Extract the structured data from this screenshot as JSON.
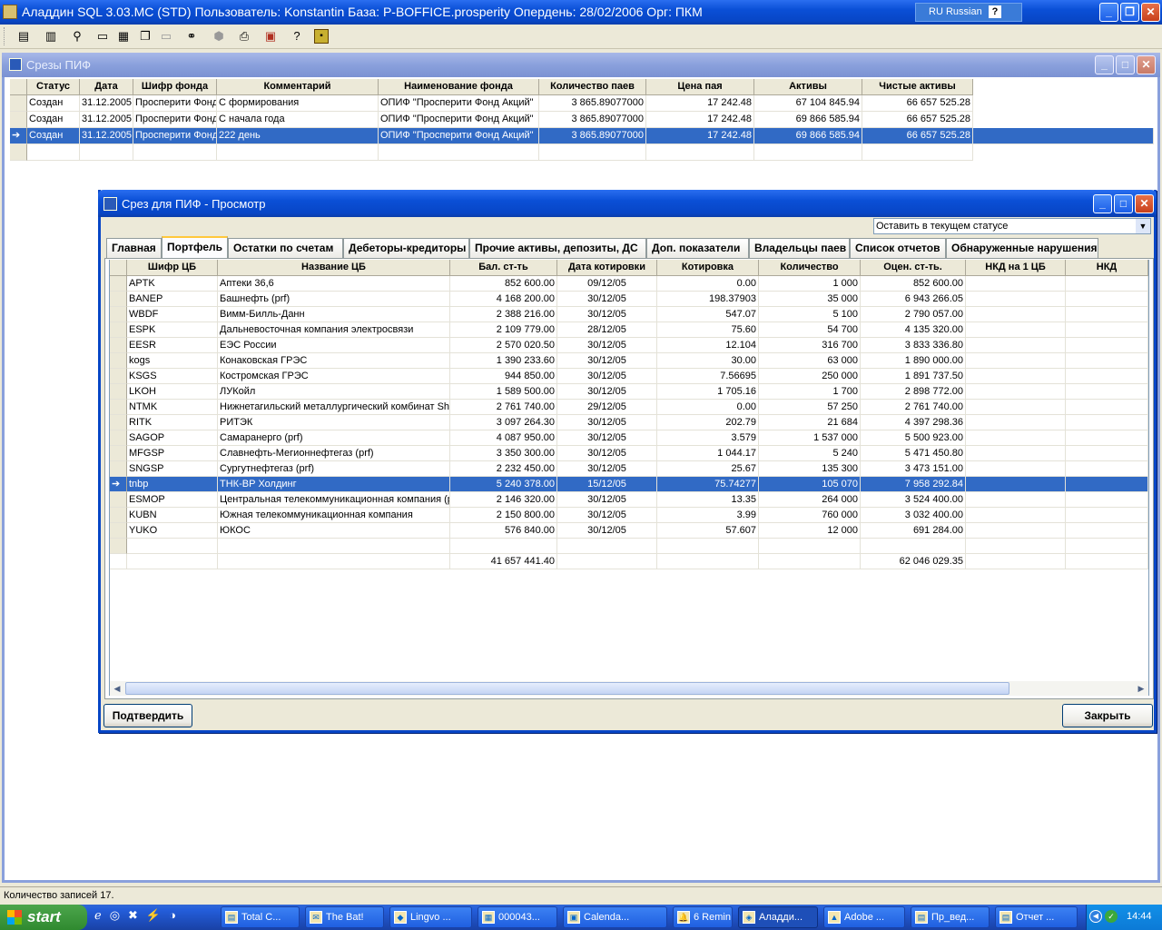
{
  "app": {
    "title": "Аладдин SQL 3.03.MC (STD)  Пользователь: Konstantin База: P-BOFFICE.prosperity Опердень: 28/02/2006 Орг: ПКМ",
    "lang": "RU Russian"
  },
  "toolbar": [
    "report-icon",
    "db-icon",
    "filter-icon",
    "window-icon",
    "tile-icon",
    "cascade-icon",
    "blank-icon",
    "binoculars-icon",
    "stop-icon",
    "print-icon",
    "export-icon",
    "help-icon",
    "module-icon"
  ],
  "outer": {
    "title": "Срезы ПИФ",
    "headers": [
      "Статус",
      "Дата",
      "Шифр фонда",
      "Комментарий",
      "Наименование фонда",
      "Количество паев",
      "Цена пая",
      "Активы",
      "Чистые активы"
    ],
    "rows": [
      [
        "Создан",
        "31.12.2005",
        "Просперити Фонд",
        "С формирования",
        "ОПИФ \"Просперити Фонд Акций\"",
        "3 865.89077000",
        "17 242.48",
        "67 104 845.94",
        "66 657 525.28"
      ],
      [
        "Создан",
        "31.12.2005",
        "Просперити Фонд",
        "С начала года",
        "ОПИФ \"Просперити Фонд Акций\"",
        "3 865.89077000",
        "17 242.48",
        "69 866 585.94",
        "66 657 525.28"
      ],
      [
        "Создан",
        "31.12.2005",
        "Просперити Фонд",
        "222 день",
        "ОПИФ \"Просперити Фонд Акций\"",
        "3 865.89077000",
        "17 242.48",
        "69 866 585.94",
        "66 657 525.28"
      ]
    ]
  },
  "dialog": {
    "title": "Срез для ПИФ - Просмотр",
    "status_select": "Оставить в текущем статусе",
    "tabs": [
      "Главная",
      "Портфель",
      "Остатки по счетам",
      "Дебеторы-кредиторы",
      "Прочие активы, депозиты, ДС",
      "Доп. показатели",
      "Владельцы паев",
      "Список отчетов",
      "Обнаруженные нарушения"
    ],
    "headers": [
      "Шифр ЦБ",
      "Название ЦБ",
      "Бал. ст-ть",
      "Дата котировки",
      "Котировка",
      "Количество",
      "Оцен. ст-ть.",
      "НКД на 1 ЦБ",
      "НКД"
    ],
    "rows": [
      [
        "APTK",
        "Аптеки 36,6",
        "852 600.00",
        "09/12/05",
        "0.00",
        "1 000",
        "852 600.00"
      ],
      [
        "BANEP",
        "Башнефть (prf)",
        "4 168 200.00",
        "30/12/05",
        "198.37903",
        "35 000",
        "6 943 266.05"
      ],
      [
        "WBDF",
        "Вимм-Билль-Данн",
        "2 388 216.00",
        "30/12/05",
        "547.07",
        "5 100",
        "2 790 057.00"
      ],
      [
        "ESPK",
        "Дальневосточная компания электросвязи",
        "2 109 779.00",
        "28/12/05",
        "75.60",
        "54 700",
        "4 135 320.00"
      ],
      [
        "EESR",
        "ЕЭС России",
        "2 570 020.50",
        "30/12/05",
        "12.104",
        "316 700",
        "3 833 336.80"
      ],
      [
        "kogs",
        "Конаковская ГРЭС",
        "1 390 233.60",
        "30/12/05",
        "30.00",
        "63 000",
        "1 890 000.00"
      ],
      [
        "KSGS",
        "Костромская ГРЭС",
        "944 850.00",
        "30/12/05",
        "7.56695",
        "250 000",
        "1 891 737.50"
      ],
      [
        "LKOH",
        "ЛУКойл",
        "1 589 500.00",
        "30/12/05",
        "1 705.16",
        "1 700",
        "2 898 772.00"
      ],
      [
        "NTMK",
        "Нижнетагильский металлургический комбинат Sh",
        "2 761 740.00",
        "29/12/05",
        "0.00",
        "57 250",
        "2 761 740.00"
      ],
      [
        "RITK",
        "РИТЭК",
        "3 097 264.30",
        "30/12/05",
        "202.79",
        "21 684",
        "4 397 298.36"
      ],
      [
        "SAGOP",
        "Самаранерго (prf)",
        "4 087 950.00",
        "30/12/05",
        "3.579",
        "1 537 000",
        "5 500 923.00"
      ],
      [
        "MFGSP",
        "Славнефть-Мегионнефтегаз (prf)",
        "3 350 300.00",
        "30/12/05",
        "1 044.17",
        "5 240",
        "5 471 450.80"
      ],
      [
        "SNGSP",
        "Сургутнефтегаз (prf)",
        "2 232 450.00",
        "30/12/05",
        "25.67",
        "135 300",
        "3 473 151.00"
      ],
      [
        "tnbp",
        "ТНК-ВР Холдинг",
        "5 240 378.00",
        "15/12/05",
        "75.74277",
        "105 070",
        "7 958 292.84"
      ],
      [
        "ESMOP",
        "Центральная телекоммуникационная компания (р",
        "2 146 320.00",
        "30/12/05",
        "13.35",
        "264 000",
        "3 524 400.00"
      ],
      [
        "KUBN",
        "Южная телекоммуникационная компания",
        "2 150 800.00",
        "30/12/05",
        "3.99",
        "760 000",
        "3 032 400.00"
      ],
      [
        "YUKO",
        "ЮКОС",
        "576 840.00",
        "30/12/05",
        "57.607",
        "12 000",
        "691 284.00"
      ]
    ],
    "total_bal": "41 657 441.40",
    "total_ocen": "62 046 029.35",
    "confirm": "Подтвердить",
    "close": "Закрыть"
  },
  "statusbar": "Количество записей 17.",
  "taskbar": {
    "start": "start",
    "items": [
      "Total C...",
      "The Bat!",
      "Lingvo ...",
      "000043...",
      "Calenda...",
      "6 Remin...",
      "Аладди...",
      "Adobe ...",
      "Пр_вед...",
      "Отчет ..."
    ],
    "clock": "14:44"
  }
}
